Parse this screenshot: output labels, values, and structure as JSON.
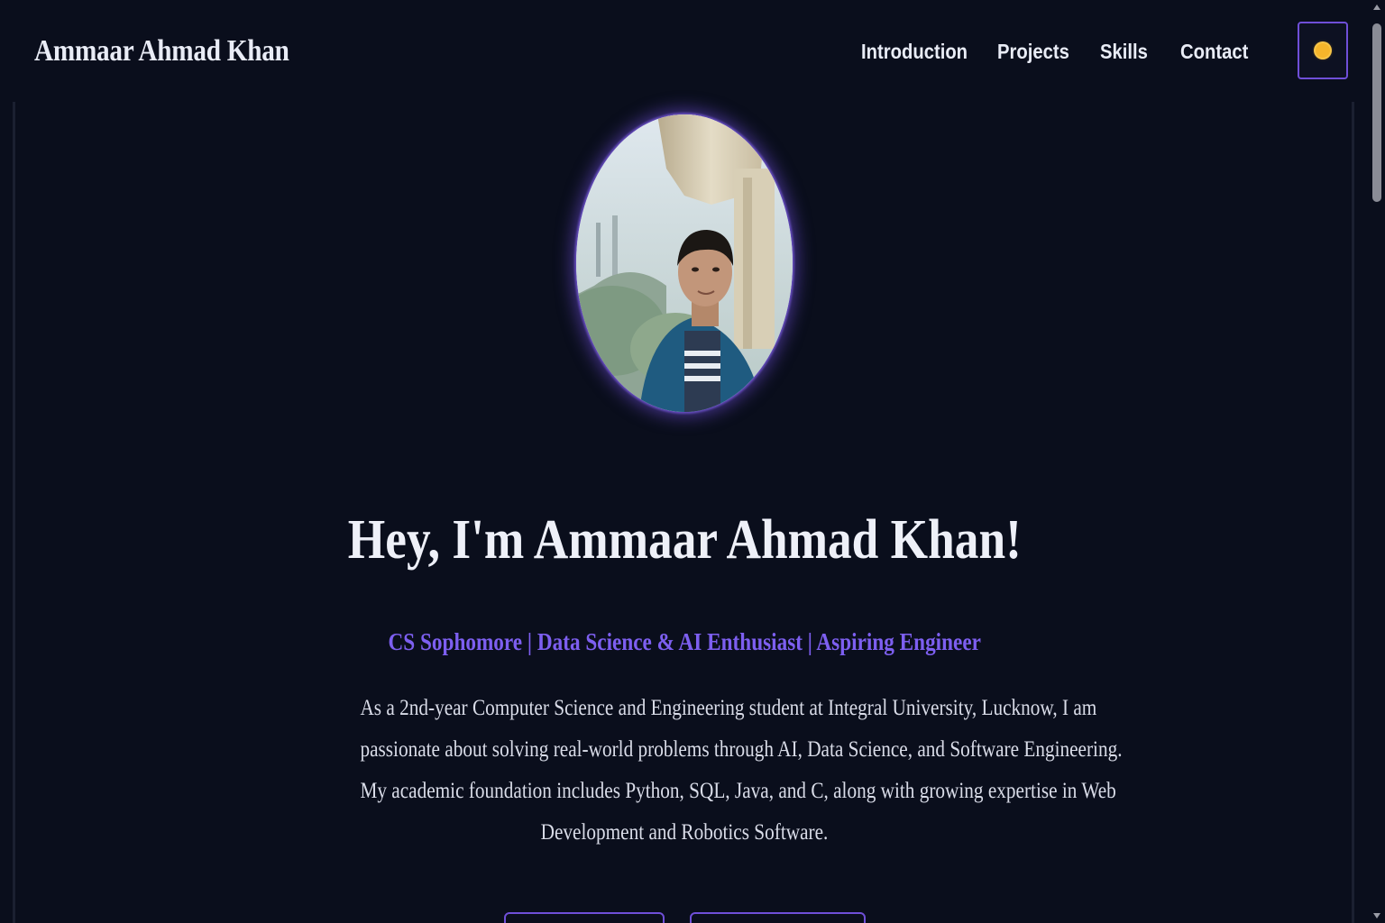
{
  "header": {
    "brand": "Ammaar Ahmad Khan",
    "nav": [
      {
        "label": "Introduction"
      },
      {
        "label": "Projects"
      },
      {
        "label": "Skills"
      },
      {
        "label": "Contact"
      }
    ],
    "theme_toggle_icon": "sun-icon"
  },
  "hero": {
    "avatar_icon": "profile-photo",
    "title": "Hey, I'm Ammaar Ahmad Khan!",
    "subtitle": "CS Sophomore | Data Science & AI Enthusiast | Aspiring Engineer",
    "description_lines": [
      "As a 2nd-year Computer Science and Engineering student at Integral University, Lucknow, I am",
      "passionate about solving real-world problems through AI, Data Science, and Software Engineering.",
      "My academic foundation includes Python, SQL, Java, and C, along with growing expertise in Web",
      "Development and Robotics Software."
    ]
  },
  "colors": {
    "background": "#0a0e1c",
    "accent": "#6f4fd8",
    "subtitle": "#7d5ff0",
    "text": "#e9ecf6"
  }
}
